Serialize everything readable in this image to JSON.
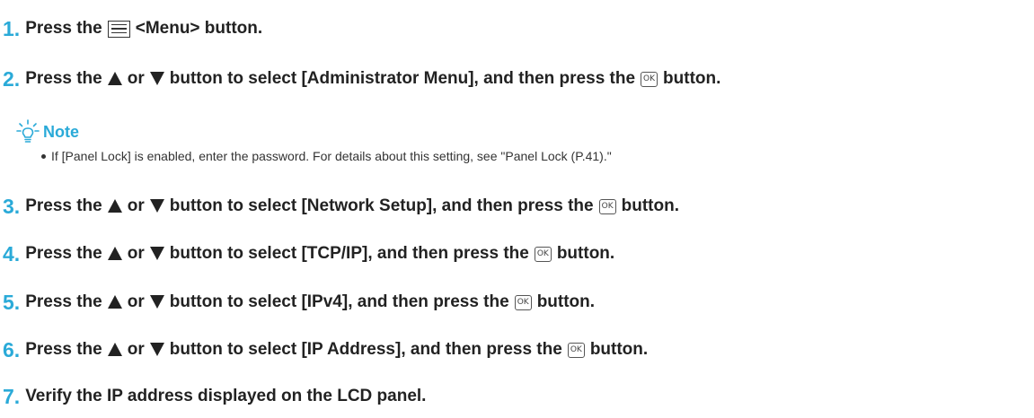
{
  "steps": [
    {
      "num": "1.",
      "parts": {
        "a": "Press the",
        "b": "<Menu> button."
      }
    },
    {
      "num": "2.",
      "parts": {
        "a": "Press the",
        "or": "or",
        "b": "button to select [Administrator Menu], and then press the",
        "c": "button."
      }
    },
    {
      "num": "3.",
      "parts": {
        "a": "Press the",
        "or": "or",
        "b": "button to select [Network Setup], and then press the",
        "c": "button."
      }
    },
    {
      "num": "4.",
      "parts": {
        "a": "Press the",
        "or": "or",
        "b": "button to select [TCP/IP], and then press the",
        "c": "button."
      }
    },
    {
      "num": "5.",
      "parts": {
        "a": "Press the",
        "or": "or",
        "b": "button to select [IPv4], and then press the",
        "c": "button."
      }
    },
    {
      "num": "6.",
      "parts": {
        "a": "Press the",
        "or": "or",
        "b": "button to select [IP Address], and then press the",
        "c": "button."
      }
    },
    {
      "num": "7.",
      "parts": {
        "a": "Verify the IP address displayed on the LCD panel."
      }
    }
  ],
  "note": {
    "label": "Note",
    "text": "If [Panel Lock] is enabled, enter the password. For details about this setting, see \"Panel Lock (P.41).\""
  },
  "ok_button_label": "OK",
  "icons": {
    "menu": "menu-icon",
    "up": "up-arrow-icon",
    "down": "down-arrow-icon",
    "ok": "ok-button-icon",
    "note": "lightbulb-icon"
  },
  "colors": {
    "accent": "#2aaad8",
    "text": "#222222"
  }
}
